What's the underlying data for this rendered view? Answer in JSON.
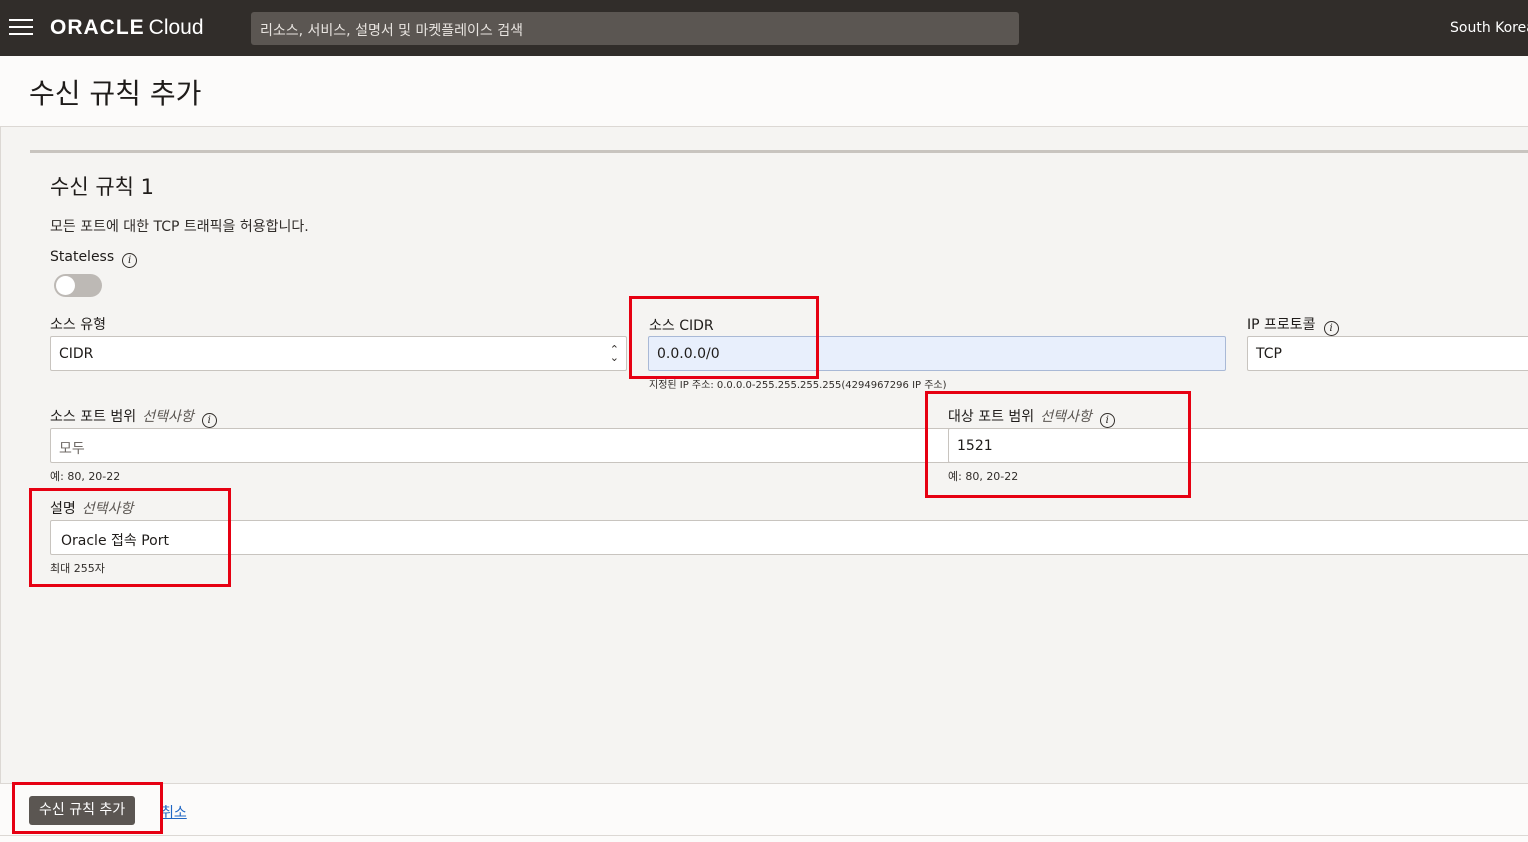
{
  "topbar": {
    "logo_brand": "ORACLE",
    "logo_product": "Cloud",
    "search_placeholder": "리소스, 서비스, 설명서 및 마켓플레이스 검색",
    "region": "South Korea"
  },
  "page": {
    "title": "수신 규칙 추가"
  },
  "rule": {
    "title": "수신 규칙 1",
    "description": "모든 포트에 대한 TCP 트래픽을 허용합니다.",
    "stateless_label": "Stateless",
    "stateless_on": false,
    "source_type_label": "소스 유형",
    "source_type_value": "CIDR",
    "source_cidr_label": "소스 CIDR",
    "source_cidr_value": "0.0.0.0/0",
    "source_cidr_hint": "지정된 IP 주소: 0.0.0.0-255.255.255.255(4294967296 IP 주소)",
    "ip_protocol_label": "IP 프로토콜",
    "ip_protocol_value": "TCP",
    "source_port_label": "소스 포트 범위",
    "optional_text": "선택사항",
    "source_port_placeholder": "모두",
    "port_hint": "예: 80, 20-22",
    "dest_port_label": "대상 포트 범위",
    "dest_port_value": "1521",
    "description_label": "설명",
    "description_value": "Oracle 접속 Port",
    "description_hint": "최대 255자"
  },
  "footer": {
    "add_button": "수신 규칙 추가",
    "cancel_link": "취소"
  },
  "icons": {
    "info": "i",
    "menu": "hamburger-icon",
    "select": "updown-chevron-icon"
  },
  "colors": {
    "topbar": "#312d2a",
    "annotation": "#e60012",
    "link": "#2067c4",
    "focus_field": "#e8effc"
  }
}
